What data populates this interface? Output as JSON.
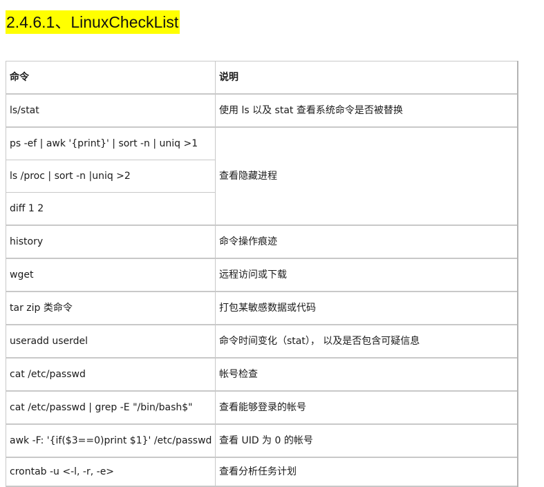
{
  "heading": "2.4.6.1、LinuxCheckList",
  "table": {
    "headers": [
      "命令",
      "说明"
    ],
    "rows": [
      {
        "command": "ls/stat",
        "description": "使用 ls  以及  stat  查看系统命令是否被替换"
      },
      {
        "command": "ps -ef | awk '{print}' | sort -n | uniq >1",
        "description": "查看隐藏进程"
      },
      {
        "command": "ls /proc | sort -n |uniq >2",
        "description": ""
      },
      {
        "command": "diff 1 2",
        "description": ""
      },
      {
        "command": "history",
        "description": "命令操作痕迹"
      },
      {
        "command": "wget",
        "description": "远程访问或下载"
      },
      {
        "command": "tar zip  类命令",
        "description": "打包某敏感数据或代码"
      },
      {
        "command": "useradd userdel",
        "description": "命令时间变化（stat），  以及是否包含可疑信息"
      },
      {
        "command": "cat /etc/passwd",
        "description": "帐号检查"
      },
      {
        "command": "cat /etc/passwd | grep -E \"/bin/bash$\"",
        "description": "查看能够登录的帐号"
      },
      {
        "command": "awk -F: '{if($3==0)print $1}' /etc/passwd",
        "description": "查看 UID 为 0 的帐号"
      },
      {
        "command": "crontab -u <-l, -r, -e>",
        "description": "查看分析任务计划"
      }
    ]
  }
}
